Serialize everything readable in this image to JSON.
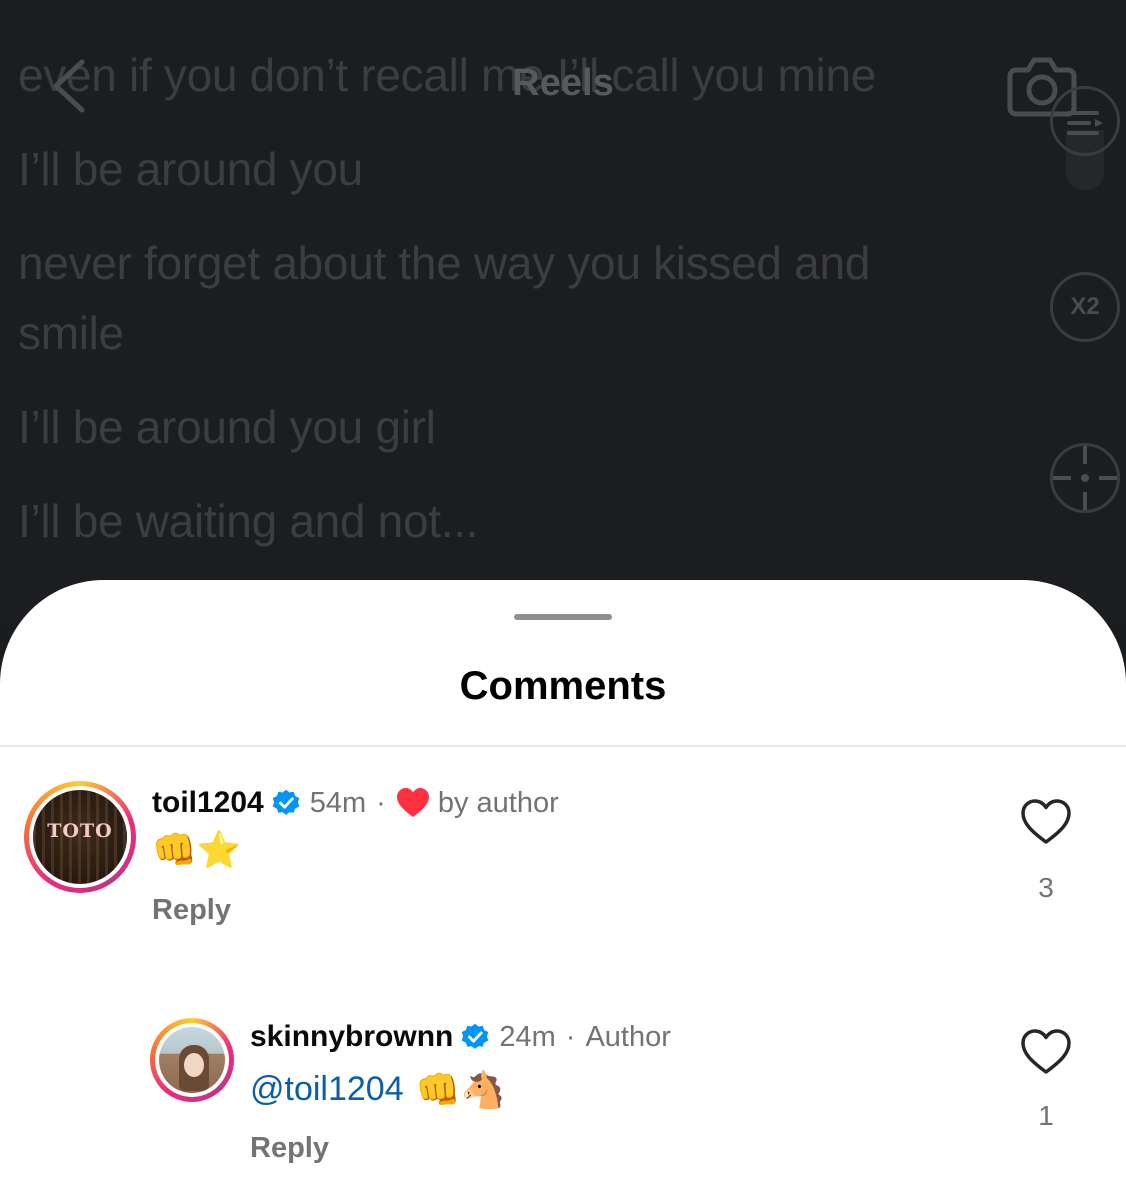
{
  "header": {
    "title": "Reels",
    "back_icon": "chevron-left-icon",
    "camera_icon": "camera-icon"
  },
  "lyrics": [
    "even if you don’t recall me I’ll call you mine",
    "I’ll be around you",
    "never forget about the way you kissed and smile",
    "I’ll be around you girl",
    "I’ll be waiting and not..."
  ],
  "side_controls": {
    "speed_label": "X2"
  },
  "comments_sheet": {
    "title": "Comments",
    "comments": [
      {
        "username": "toil1204",
        "avatar_text": "TOTO",
        "verified": true,
        "time": "54m",
        "liked_by_author_label": "by author",
        "body_emojis": "👊⭐",
        "reply_label": "Reply",
        "like_count": "3"
      },
      {
        "username": "skinnybrownn",
        "verified": true,
        "time": "24m",
        "author_tag": "Author",
        "mention": "@toil1204",
        "body_emojis": "👊🐴",
        "reply_label": "Reply",
        "like_count": "1"
      }
    ]
  },
  "colors": {
    "verified_blue": "#0095f6",
    "heart_red": "#ff3040",
    "mention_blue": "#0d5ea8",
    "muted_text": "#737373"
  }
}
